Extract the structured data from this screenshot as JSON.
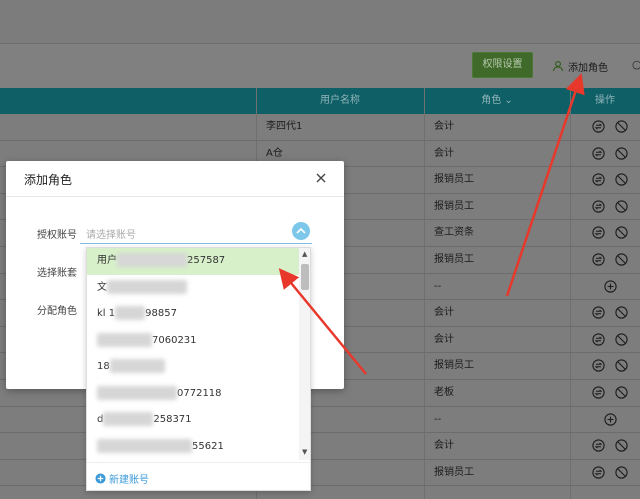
{
  "toolbar": {
    "perm_label": "权限设置",
    "add_role_label": "添加角色"
  },
  "table": {
    "headers": {
      "name": "用户名称",
      "role": "角色",
      "ops": "操作"
    },
    "rows": [
      {
        "name": "李四代1",
        "role": "会计",
        "ops": "edit-delete"
      },
      {
        "name": "A仓",
        "role": "会计",
        "ops": "edit-delete"
      },
      {
        "name": "",
        "role": "报销员工",
        "ops": "edit-delete"
      },
      {
        "name": "",
        "role": "报销员工",
        "ops": "edit-delete"
      },
      {
        "name": "",
        "role": "查工资条",
        "ops": "edit-delete"
      },
      {
        "name": "",
        "role": "报销员工",
        "ops": "edit-delete"
      },
      {
        "name": "",
        "role": "--",
        "ops": "add"
      },
      {
        "name": "",
        "role": "会计",
        "ops": "edit-delete"
      },
      {
        "name": "",
        "role": "会计",
        "ops": "edit-delete"
      },
      {
        "name": "",
        "role": "报销员工",
        "ops": "edit-delete"
      },
      {
        "name": "",
        "role": "老板",
        "ops": "edit-delete"
      },
      {
        "name": "",
        "role": "--",
        "ops": "add"
      },
      {
        "name": "",
        "role": "会计",
        "ops": "edit-delete"
      },
      {
        "name": "",
        "role": "报销员工",
        "ops": "edit-delete"
      }
    ]
  },
  "modal": {
    "title": "添加角色",
    "labels": {
      "auth_account": "授权账号",
      "select_set": "选择账套",
      "assign_role": "分配角色"
    },
    "placeholder": "请选择账号"
  },
  "dropdown": {
    "items": [
      {
        "prefix": "用户",
        "suffix": "257587",
        "blur_w": 70
      },
      {
        "prefix": "文",
        "suffix": "",
        "blur_w": 80
      },
      {
        "prefix": "kl 1",
        "suffix": "98857",
        "blur_w": 30
      },
      {
        "prefix": "",
        "suffix": "7060231",
        "blur_w": 55
      },
      {
        "prefix": "18",
        "suffix": "",
        "blur_w": 55
      },
      {
        "prefix": "",
        "suffix": "0772118",
        "blur_w": 80
      },
      {
        "prefix": "d",
        "suffix": "258371",
        "blur_w": 50
      },
      {
        "prefix": "",
        "suffix": "55621",
        "blur_w": 95
      }
    ],
    "new_account_label": "新建账号"
  },
  "colors": {
    "annotation": "#e8382c",
    "active_item": "#d7f0c9",
    "link": "#3c9ad9"
  }
}
